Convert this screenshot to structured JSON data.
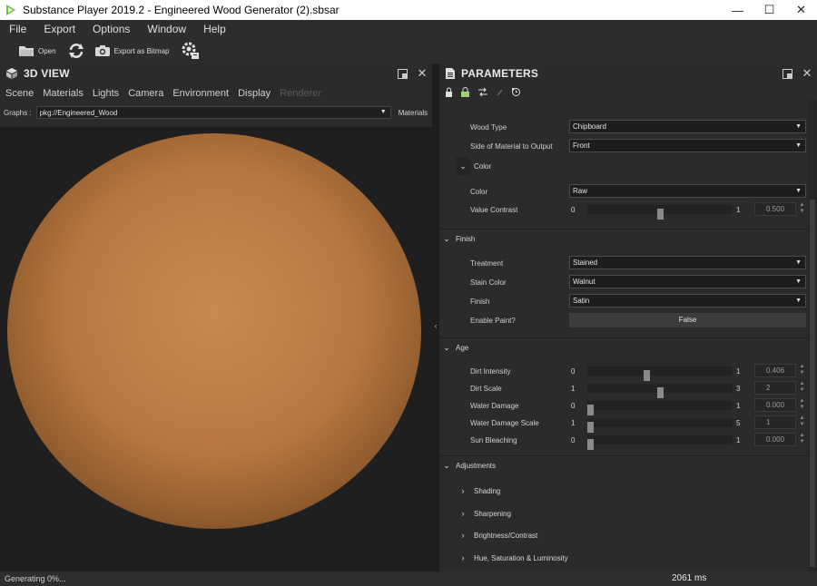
{
  "window": {
    "title": "Substance Player 2019.2 - Engineered Wood Generator (2).sbsar",
    "minimize": "—",
    "maximize": "☐",
    "close": "✕"
  },
  "menu": [
    "File",
    "Export",
    "Options",
    "Window",
    "Help"
  ],
  "toolbar": {
    "open_label": "Open",
    "export_label": "Export as Bitmap"
  },
  "view3d": {
    "title": "3D VIEW",
    "tabs": [
      "Scene",
      "Materials",
      "Lights",
      "Camera",
      "Environment",
      "Display",
      "Renderer"
    ],
    "graphs_label": "Graphs :",
    "graph_value": "pkg://Engineered_Wood",
    "materials_link": "Materials",
    "sphere_color": "#b8773f"
  },
  "params": {
    "title": "PARAMETERS",
    "wood_type": {
      "label": "Wood Type",
      "value": "Chipboard"
    },
    "side": {
      "label": "Side of Material to Output",
      "value": "Front"
    },
    "color_group": {
      "title": "Color"
    },
    "color": {
      "label": "Color",
      "value": "Raw"
    },
    "value_contrast": {
      "label": "Value Contrast",
      "min": "0",
      "max": "1",
      "value": "0.500",
      "fraction": 0.5
    },
    "finish_section": {
      "title": "Finish"
    },
    "treatment": {
      "label": "Treatment",
      "value": "Stained"
    },
    "stain_color": {
      "label": "Stain Color",
      "value": "Walnut"
    },
    "finish": {
      "label": "Finish",
      "value": "Satin"
    },
    "enable_paint": {
      "label": "Enable Paint?",
      "value": "False"
    },
    "age_section": {
      "title": "Age"
    },
    "dirt_intensity": {
      "label": "Dirt Intensity",
      "min": "0",
      "max": "1",
      "value": "0.406",
      "fraction": 0.406
    },
    "dirt_scale": {
      "label": "Dirt Scale",
      "min": "1",
      "max": "3",
      "value": "2",
      "fraction": 0.5
    },
    "water_damage": {
      "label": "Water Damage",
      "min": "0",
      "max": "1",
      "value": "0.000",
      "fraction": 0
    },
    "water_damage_scale": {
      "label": "Water Damage Scale",
      "min": "1",
      "max": "5",
      "value": "1",
      "fraction": 0
    },
    "sun_bleaching": {
      "label": "Sun Bleaching",
      "min": "0",
      "max": "1",
      "value": "0.000",
      "fraction": 0
    },
    "adjustments_section": {
      "title": "Adjustments"
    },
    "shading": {
      "title": "Shading"
    },
    "sharpening": {
      "title": "Sharpening"
    },
    "brightness": {
      "title": "Brightness/Contrast"
    },
    "hsl": {
      "title": "Hue, Saturation & Luminosity"
    }
  },
  "status": {
    "left": "Generating 0%...",
    "right": "2061 ms"
  }
}
